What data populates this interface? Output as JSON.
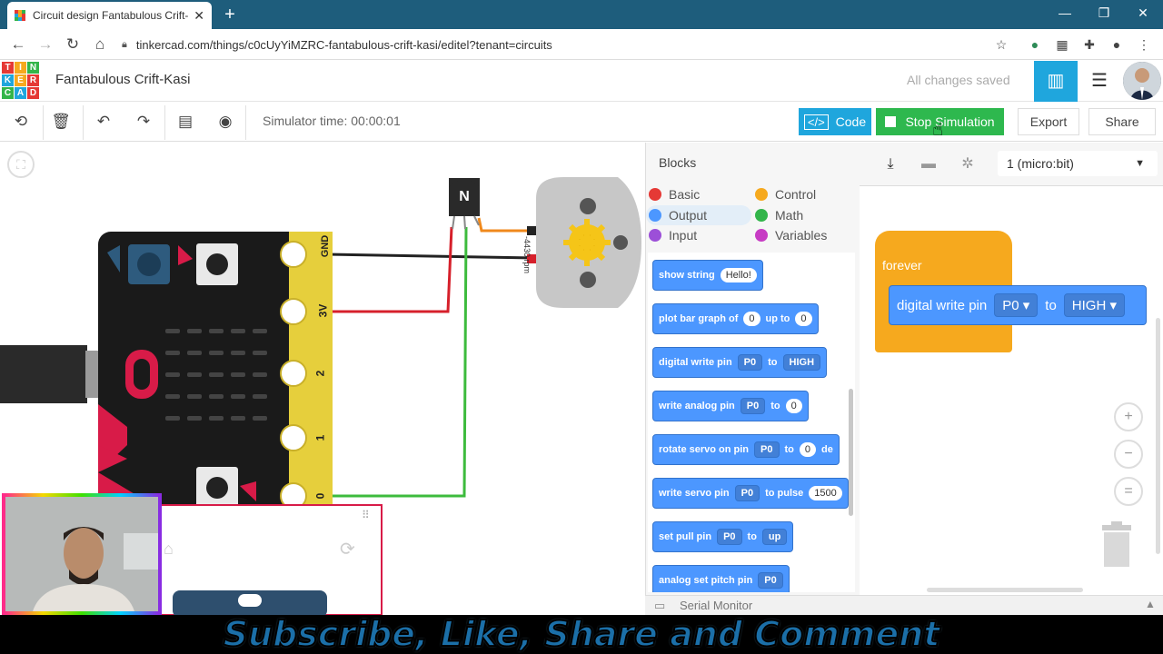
{
  "browser": {
    "tab_title": "Circuit design Fantabulous Crift-",
    "url": "tinkercad.com/things/c0cUyYiMZRC-fantabulous-crift-kasi/editel?tenant=circuits",
    "tab_close": "✕",
    "new_tab": "+"
  },
  "header": {
    "logo_letters": [
      "T",
      "I",
      "N",
      "K",
      "E",
      "R",
      "C",
      "A",
      "D"
    ],
    "project_name": "Fantabulous Crift-Kasi",
    "save_status": "All changes saved"
  },
  "toolbar": {
    "sim_time": "Simulator time: 00:00:01",
    "code_label": "Code",
    "stop_label": "Stop Simulation",
    "export_label": "Export",
    "share_label": "Share"
  },
  "circuit": {
    "transistor_label": "N",
    "motor_label": "-4430 rpm",
    "pins": [
      "GND",
      "3V",
      "2",
      "1",
      "0"
    ]
  },
  "blocks": {
    "header": "Blocks",
    "categories": [
      {
        "label": "Basic",
        "color": "#e53935"
      },
      {
        "label": "Control",
        "color": "#f6a91e"
      },
      {
        "label": "Output",
        "color": "#4c97ff"
      },
      {
        "label": "Math",
        "color": "#33b54a"
      },
      {
        "label": "Input",
        "color": "#9c4fd8"
      },
      {
        "label": "Variables",
        "color": "#c73cc4"
      }
    ],
    "items": [
      {
        "label": "show string",
        "arg1": "Hello!"
      },
      {
        "label": "plot bar graph of",
        "arg1": "0",
        "mid": "up to",
        "arg2": "0"
      },
      {
        "label": "digital write pin",
        "arg1": "P0",
        "mid": "to",
        "arg2": "HIGH"
      },
      {
        "label": "write analog pin",
        "arg1": "P0",
        "mid": "to",
        "arg2": "0"
      },
      {
        "label": "rotate servo on pin",
        "arg1": "P0",
        "mid": "to",
        "arg2": "0",
        "tail": "de"
      },
      {
        "label": "write servo pin",
        "arg1": "P0",
        "mid": "to pulse",
        "arg2": "1500"
      },
      {
        "label": "set pull pin",
        "arg1": "P0",
        "mid": "to",
        "arg2": "up"
      },
      {
        "label": "analog set pitch pin",
        "arg1": "P0"
      }
    ],
    "serial_monitor": "Serial Monitor"
  },
  "code": {
    "device": "1 (micro:bit)",
    "forever_label": "forever",
    "stmt_label": "digital write pin",
    "stmt_pin": "P0",
    "stmt_to": "to",
    "stmt_value": "HIGH"
  },
  "banner": {
    "text": "Subscribe, Like, Share and Comment"
  }
}
